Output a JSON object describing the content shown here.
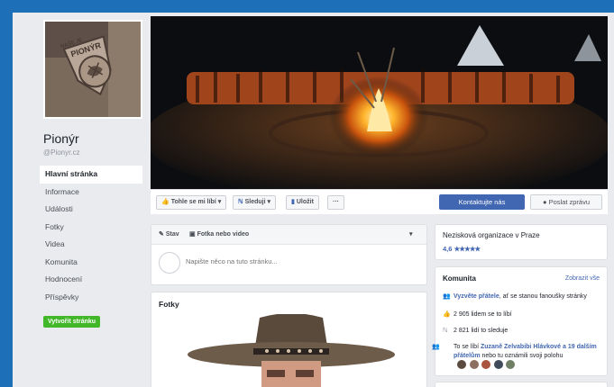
{
  "page": {
    "name": "Pionýr",
    "handle": "@Pionyr.cz",
    "create_page_label": "Vytvořit stránku"
  },
  "nav": {
    "items": [
      {
        "label": "Hlavní stránka",
        "active": true
      },
      {
        "label": "Informace"
      },
      {
        "label": "Události"
      },
      {
        "label": "Fotky"
      },
      {
        "label": "Videa"
      },
      {
        "label": "Komunita"
      },
      {
        "label": "Hodnocení"
      },
      {
        "label": "Příspěvky"
      }
    ]
  },
  "logo": {
    "arc_text": "PIONÝR",
    "ring_text": "NAŠE JE"
  },
  "actions": {
    "like_label": "Tohle se mi líbí",
    "follow_label": "Sleduji",
    "save_label": "Uložit",
    "more_label": "···",
    "contact_label": "Kontaktujte nás",
    "message_label": "Poslat zprávu"
  },
  "composer": {
    "status_tab": "Stav",
    "photo_tab": "Fotka nebo video",
    "placeholder": "Napište něco na tuto stránku..."
  },
  "photos": {
    "title": "Fotky"
  },
  "info": {
    "category": "Nezisková organizace v Praze",
    "rating": "4,6",
    "stars": "★★★★★"
  },
  "community": {
    "title": "Komunita",
    "see_all": "Zobrazit vše",
    "invite_link": "Vyzvěte přátele",
    "invite_rest": ", ať se stanou fanoušky stránky",
    "likes": "2 905 lidem se to líbí",
    "follows": "2 821 lidí to sleduje",
    "friends_pre": "To se líbí ",
    "friends_name": "Zuzaně Zelvabibi Hlávkové a 19 dalším přátelům",
    "friends_rest": " nebo tu oznámili svoji polohu"
  },
  "colors": {
    "brand_blue": "#4267b2",
    "top_bar": "#1d6fb7",
    "create_green": "#42b72a",
    "background": "#e9ebee"
  }
}
